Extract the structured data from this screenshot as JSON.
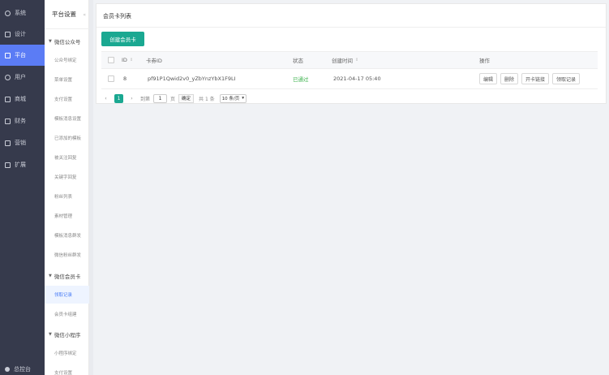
{
  "nav": {
    "items": [
      {
        "label": "系统",
        "icon": "gear-icon"
      },
      {
        "label": "设计",
        "icon": "design-icon"
      },
      {
        "label": "平台",
        "icon": "platform-icon"
      },
      {
        "label": "用户",
        "icon": "user-icon"
      },
      {
        "label": "商城",
        "icon": "store-icon"
      },
      {
        "label": "财务",
        "icon": "finance-icon"
      },
      {
        "label": "营销",
        "icon": "marketing-icon"
      },
      {
        "label": "扩展",
        "icon": "extension-icon"
      }
    ],
    "active_index": 2,
    "bottom_label": "总控台"
  },
  "sub": {
    "title": "平台设置",
    "collapse_glyph": "«",
    "groups": [
      {
        "label": "微信公众号",
        "items": [
          "公众号绑定",
          "菜单设置",
          "支付设置",
          "模板消息设置",
          "已添加的模板",
          "被关注回复",
          "关键字回复",
          "粉丝列表",
          "素材管理",
          "模板消息群发",
          "微信粉丝群发"
        ]
      },
      {
        "label": "微信会员卡",
        "items": [
          "领取记录",
          "会员卡组建"
        ]
      },
      {
        "label": "微信小程序",
        "items": [
          "小程序绑定",
          "支付设置"
        ]
      }
    ],
    "active_item": "领取记录"
  },
  "main": {
    "card_title": "会员卡列表",
    "create_button": "创建会员卡",
    "table": {
      "headers": [
        "ID",
        "卡券ID",
        "状态",
        "创建时间",
        "操作"
      ],
      "rows": [
        {
          "id": "8",
          "card_id": "pf91P1Qwid2v0_yZbYnzYbX1F9LI",
          "status": "已通过",
          "created": "2021-04-17 05:40",
          "actions": [
            "编辑",
            "删除",
            "开卡链接",
            "领取记录"
          ]
        }
      ]
    },
    "pager": {
      "prev": "‹",
      "current": "1",
      "next": "›",
      "goto_label": "到第",
      "goto_value": "1",
      "page_unit": "页",
      "confirm": "确定",
      "total": "共 1 条",
      "page_size": "10 条/页"
    }
  },
  "colors": {
    "nav_bg": "#363a4c",
    "nav_active": "#5b7cf5",
    "accent": "#1aa891",
    "status_ok": "#3fb34f"
  }
}
